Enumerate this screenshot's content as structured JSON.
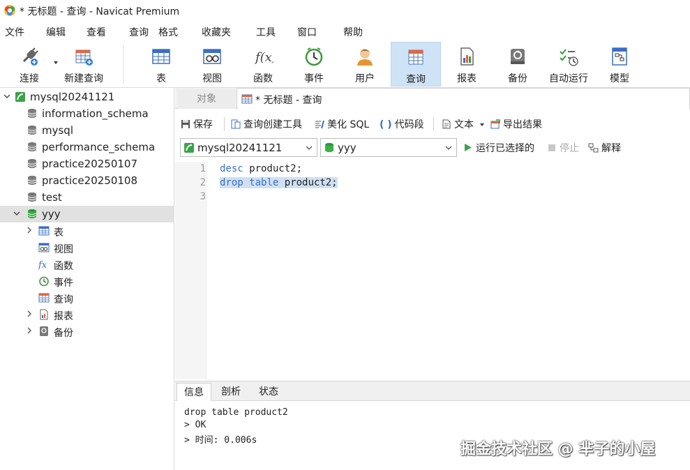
{
  "window": {
    "title": "* 无标题 - 查询 - Navicat Premium"
  },
  "menu": [
    "文件",
    "编辑",
    "查看",
    "查询",
    "格式",
    "收藏夹",
    "工具",
    "窗口",
    "帮助"
  ],
  "toolbar": {
    "connect": "连接",
    "new_query": "新建查询",
    "table": "表",
    "view": "视图",
    "function": "函数",
    "event": "事件",
    "user": "用户",
    "query": "查询",
    "report": "报表",
    "backup": "备份",
    "automation": "自动运行",
    "model": "模型"
  },
  "tree": {
    "connection": "mysql20241121",
    "databases": [
      "information_schema",
      "mysql",
      "performance_schema",
      "practice20250107",
      "practice20250108",
      "test",
      "yyy"
    ],
    "yyy_children": [
      "表",
      "视图",
      "函数",
      "事件",
      "查询",
      "报表",
      "备份"
    ]
  },
  "tabs": {
    "objects": "对象",
    "query_tab": "* 无标题 - 查询"
  },
  "query_toolbar": {
    "save": "保存",
    "builder": "查询创建工具",
    "beautify": "美化 SQL",
    "snippet": "代码段",
    "text": "文本",
    "export": "导出结果"
  },
  "selectors": {
    "connection": "mysql20241121",
    "database": "yyy",
    "run_selected": "运行已选择的",
    "stop": "停止",
    "explain": "解释"
  },
  "editor": {
    "line_numbers": [
      "1",
      "2",
      "3"
    ],
    "line1_kw": "desc",
    "line1_rest": " product2;",
    "line2_kw1": "drop",
    "line2_kw2": "table",
    "line2_rest": " product2;"
  },
  "results": {
    "tabs": [
      "信息",
      "剖析",
      "状态"
    ],
    "lines": [
      "drop table product2",
      "> OK",
      "> 时间: 0.006s"
    ]
  },
  "watermark": "掘金技术社区 @ 芈子的小屋"
}
